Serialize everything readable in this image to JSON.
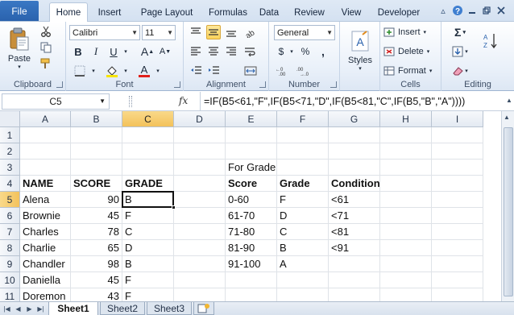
{
  "ribbon_tabs": [
    "File",
    "Home",
    "Insert",
    "Page Layout",
    "Formulas",
    "Data",
    "Review",
    "View",
    "Developer"
  ],
  "active_tab": "Home",
  "clipboard": {
    "paste": "Paste",
    "label": "Clipboard"
  },
  "font": {
    "name": "Calibri",
    "size": "11",
    "bold": "B",
    "italic": "I",
    "underline": "U",
    "grow": "A",
    "shrink": "A",
    "color_letter": "A",
    "label": "Font"
  },
  "alignment": {
    "label": "Alignment"
  },
  "number": {
    "format": "General",
    "currency": "$",
    "percent": "%",
    "comma": ",",
    "label": "Number"
  },
  "styles": {
    "label": "Styles"
  },
  "cells": {
    "insert": "Insert",
    "delete": "Delete",
    "format": "Format",
    "label": "Cells"
  },
  "editing": {
    "sum": "Σ",
    "label": "Editing"
  },
  "formula_bar": {
    "name_box": "C5",
    "fx": "fx",
    "formula": "=IF(B5<61,\"F\",IF(B5<71,\"D\",IF(B5<81,\"C\",IF(B5,\"B\",\"A\"))))"
  },
  "columns": [
    "A",
    "B",
    "C",
    "D",
    "E",
    "F",
    "G",
    "H",
    "I"
  ],
  "active_column": "C",
  "rows": [
    "1",
    "2",
    "3",
    "4",
    "5",
    "6",
    "7",
    "8",
    "9",
    "10",
    "11"
  ],
  "active_row": "5",
  "cells_data": {
    "E3": "For Grade",
    "A4": "NAME",
    "B4": "SCORE",
    "C4": "GRADE",
    "E4": "Score",
    "F4": "Grade",
    "G4": "Condition",
    "A5": "Alena",
    "B5": "90",
    "C5": "B",
    "E5": "0-60",
    "F5": "F",
    "G5": "<61",
    "A6": "Brownie",
    "B6": "45",
    "C6": "F",
    "E6": "61-70",
    "F6": "D",
    "G6": "<71",
    "A7": "Charles",
    "B7": "78",
    "C7": "C",
    "E7": "71-80",
    "F7": "C",
    "G7": "<81",
    "A8": "Charlie",
    "B8": "65",
    "C8": "D",
    "E8": "81-90",
    "F8": "B",
    "G8": "<91",
    "A9": "Chandler",
    "B9": "98",
    "C9": "B",
    "E9": "91-100",
    "F9": "A",
    "A10": "Daniella",
    "B10": "45",
    "C10": "F",
    "A11": "Doremon",
    "B11": "43",
    "C11": "F"
  },
  "sheets": [
    "Sheet1",
    "Sheet2",
    "Sheet3"
  ],
  "active_sheet": "Sheet1",
  "colors": {
    "file_tab": "#2a62ad",
    "selection_header": "#f3c25b",
    "ribbon_bg": "#e9f0f9"
  }
}
